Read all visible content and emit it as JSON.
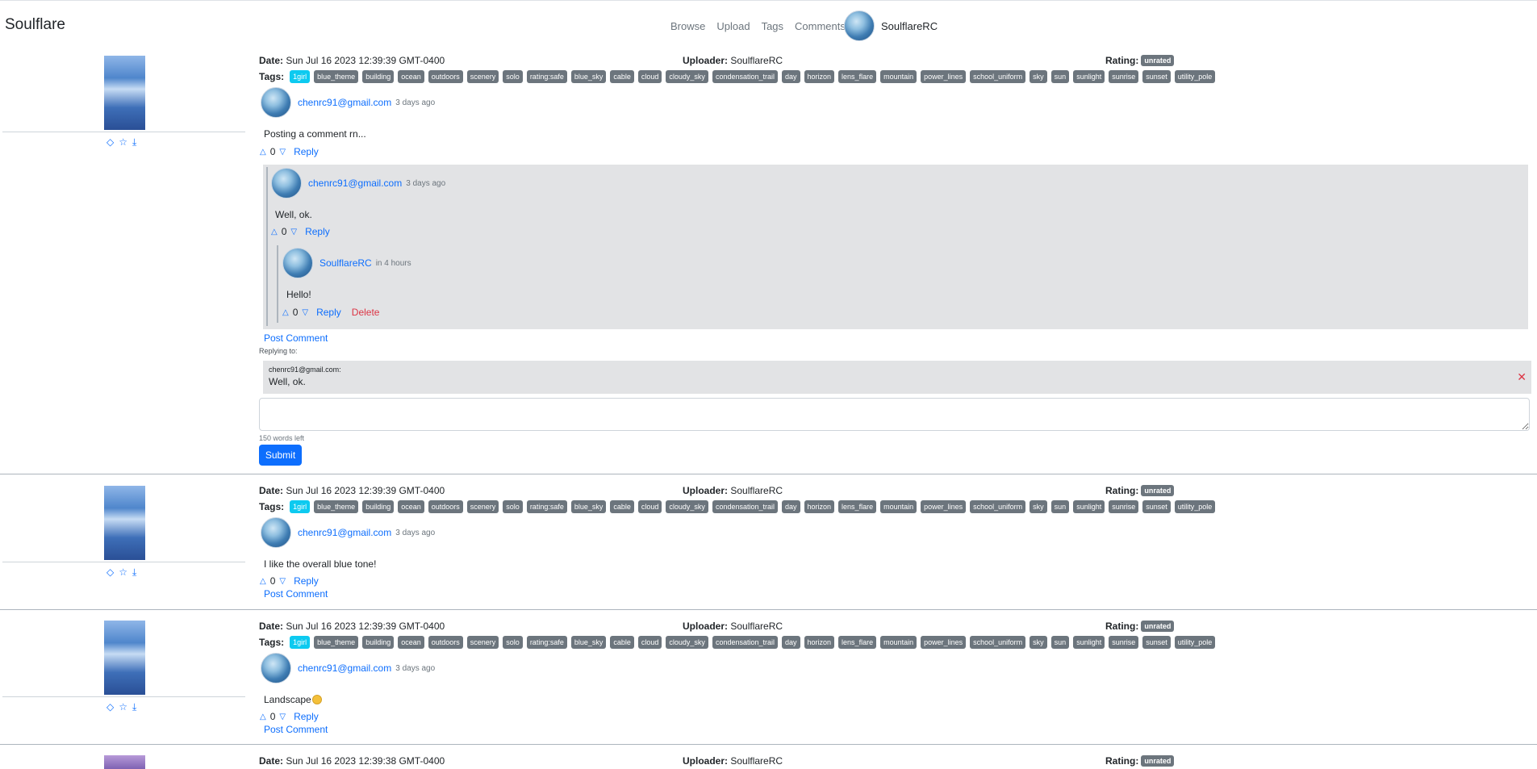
{
  "nav": {
    "brand": "Soulflare",
    "links": [
      "Browse",
      "Upload",
      "Tags",
      "Comments"
    ],
    "username": "SoulflareRC"
  },
  "labels": {
    "date": "Date:",
    "uploader": "Uploader:",
    "rating": "Rating:",
    "tags": "Tags:",
    "reply": "Reply",
    "delete": "Delete",
    "post_comment": "Post Comment",
    "replying_to": "Replying to:",
    "words_left": "150 words left",
    "submit": "Submit"
  },
  "tags": [
    "1girl",
    "blue_theme",
    "building",
    "ocean",
    "outdoors",
    "scenery",
    "solo",
    "rating:safe",
    "blue_sky",
    "cable",
    "cloud",
    "cloudy_sky",
    "condensation_trail",
    "day",
    "horizon",
    "lens_flare",
    "mountain",
    "power_lines",
    "school_uniform",
    "sky",
    "sun",
    "sunlight",
    "sunrise",
    "sunset",
    "utility_pole"
  ],
  "posts": [
    {
      "date": "Sun Jul 16 2023 12:39:39 GMT-0400",
      "uploader": "SoulflareRC",
      "rating": "unrated",
      "comment": {
        "author": "chenrc91@gmail.com",
        "when": "3 days ago",
        "text": "Posting a comment rn...",
        "votes": "0",
        "reply": {
          "author": "chenrc91@gmail.com",
          "when": "3 days ago",
          "text": "Well, ok.",
          "votes": "0",
          "reply": {
            "author": "SoulflareRC",
            "when": "in 4 hours",
            "text": "Hello!",
            "votes": "0"
          }
        }
      },
      "replying": {
        "author": "chenrc91@gmail.com:",
        "text": "Well, ok."
      }
    },
    {
      "date": "Sun Jul 16 2023 12:39:39 GMT-0400",
      "uploader": "SoulflareRC",
      "rating": "unrated",
      "comment": {
        "author": "chenrc91@gmail.com",
        "when": "3 days ago",
        "text": "I like the overall blue tone!",
        "votes": "0"
      }
    },
    {
      "date": "Sun Jul 16 2023 12:39:39 GMT-0400",
      "uploader": "SoulflareRC",
      "rating": "unrated",
      "comment": {
        "author": "chenrc91@gmail.com",
        "when": "3 days ago",
        "text": "Landscape",
        "votes": "0"
      }
    },
    {
      "date": "Sun Jul 16 2023 12:39:38 GMT-0400",
      "uploader": "SoulflareRC",
      "rating": "unrated"
    }
  ]
}
